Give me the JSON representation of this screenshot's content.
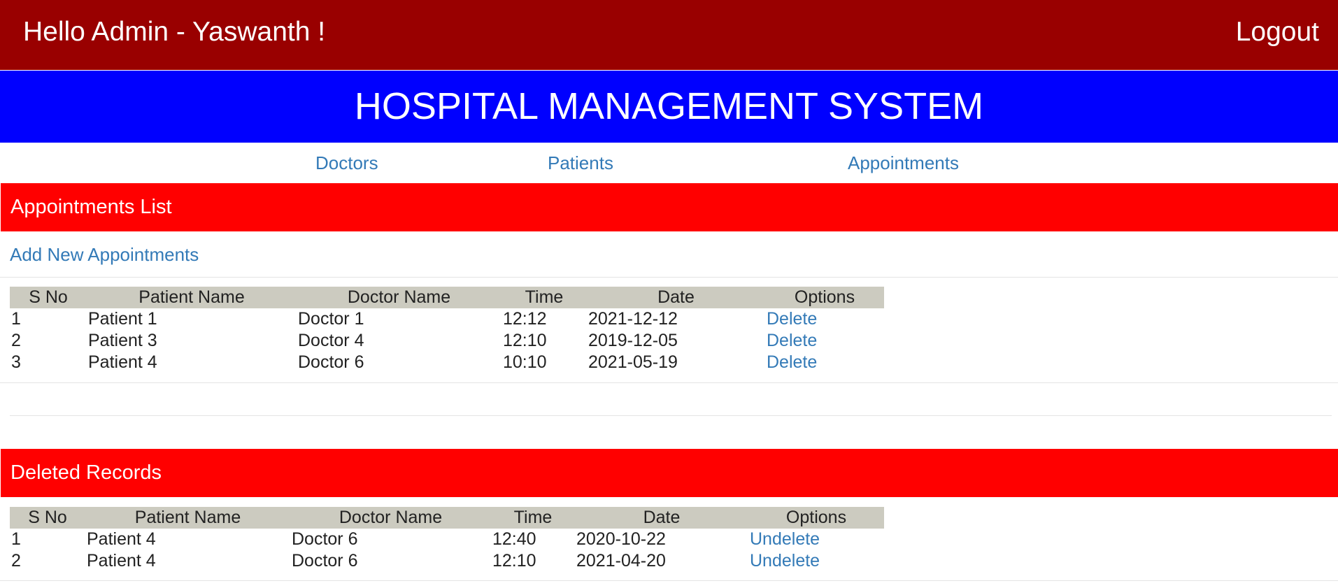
{
  "header": {
    "greeting": "Hello Admin - Yaswanth !",
    "logout_label": "Logout",
    "color": "#990000"
  },
  "title_bar": {
    "title": "HOSPITAL MANAGEMENT SYSTEM",
    "color": "#0000ff"
  },
  "nav": {
    "items": [
      {
        "label": "Doctors"
      },
      {
        "label": "Patients"
      },
      {
        "label": "Appointments"
      }
    ]
  },
  "appointments": {
    "heading": "Appointments List",
    "add_label": "Add New Appointments",
    "columns": [
      "S No",
      "Patient Name",
      "Doctor Name",
      "Time",
      "Date",
      "Options"
    ],
    "rows": [
      {
        "sno": "1",
        "patient": "Patient 1",
        "doctor": "Doctor 1",
        "time": "12:12",
        "date": "2021-12-12",
        "option": "Delete"
      },
      {
        "sno": "2",
        "patient": "Patient 3",
        "doctor": "Doctor 4",
        "time": "12:10",
        "date": "2019-12-05",
        "option": "Delete"
      },
      {
        "sno": "3",
        "patient": "Patient 4",
        "doctor": "Doctor 6",
        "time": "10:10",
        "date": "2021-05-19",
        "option": "Delete"
      }
    ]
  },
  "deleted": {
    "heading": "Deleted Records",
    "columns": [
      "S No",
      "Patient Name",
      "Doctor Name",
      "Time",
      "Date",
      "Options"
    ],
    "rows": [
      {
        "sno": "1",
        "patient": "Patient 4",
        "doctor": "Doctor 6",
        "time": "12:40",
        "date": "2020-10-22",
        "option": "Undelete"
      },
      {
        "sno": "2",
        "patient": "Patient 4",
        "doctor": "Doctor 6",
        "time": "12:10",
        "date": "2021-04-20",
        "option": "Undelete"
      }
    ]
  },
  "colors": {
    "section_header": "#ff0000",
    "link": "#337ab7",
    "table_header_bg": "#cccbc0"
  }
}
